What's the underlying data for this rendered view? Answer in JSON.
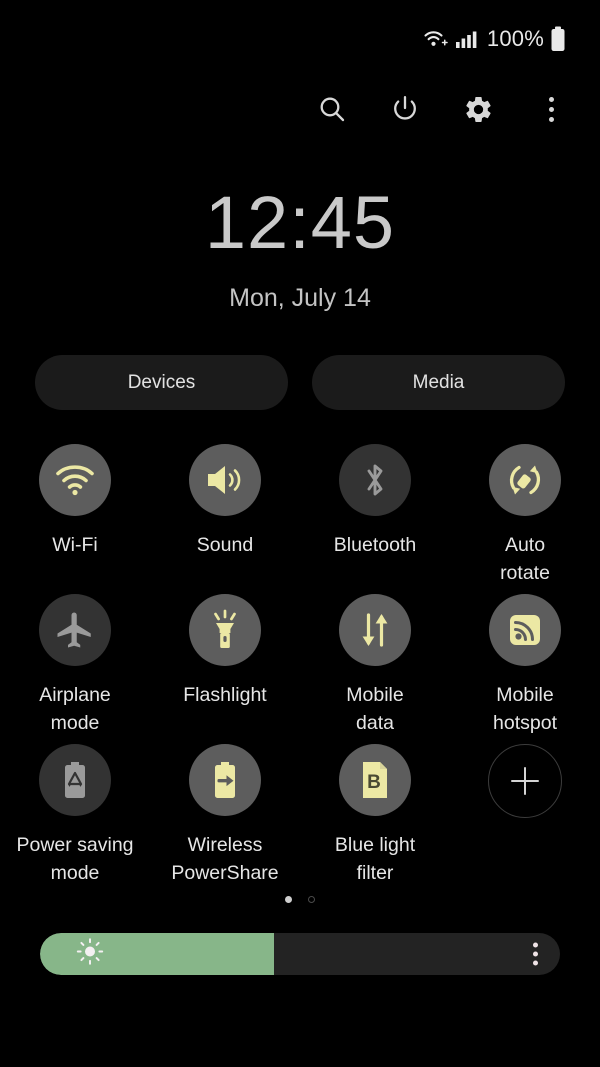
{
  "status_bar": {
    "wifi_icon": "wifi-plus-icon",
    "signal_icon": "cellular-signal-icon",
    "battery_percent": "100%",
    "battery_icon": "battery-full-icon"
  },
  "toolbar": {
    "buttons": [
      {
        "name": "search-icon",
        "label": "Search"
      },
      {
        "name": "power-icon",
        "label": "Power"
      },
      {
        "name": "settings-gear-icon",
        "label": "Settings"
      },
      {
        "name": "overflow-menu-icon",
        "label": "More options"
      }
    ]
  },
  "clock": {
    "time": "12:45",
    "date": "Mon, July 14"
  },
  "shortcuts": {
    "devices_label": "Devices",
    "media_label": "Media"
  },
  "tiles": [
    {
      "name": "wifi",
      "label": "Wi-Fi",
      "state": "on",
      "icon": "wifi-icon"
    },
    {
      "name": "sound",
      "label": "Sound",
      "state": "on",
      "icon": "sound-icon"
    },
    {
      "name": "bluetooth",
      "label": "Bluetooth",
      "state": "off",
      "icon": "bluetooth-icon"
    },
    {
      "name": "auto-rotate",
      "label": "Auto\nrotate",
      "state": "on",
      "icon": "auto-rotate-icon"
    },
    {
      "name": "airplane-mode",
      "label": "Airplane\nmode",
      "state": "off",
      "icon": "airplane-icon"
    },
    {
      "name": "flashlight",
      "label": "Flashlight",
      "state": "on",
      "icon": "flashlight-icon"
    },
    {
      "name": "mobile-data",
      "label": "Mobile\ndata",
      "state": "on",
      "icon": "mobile-data-icon"
    },
    {
      "name": "mobile-hotspot",
      "label": "Mobile\nhotspot",
      "state": "on",
      "icon": "hotspot-icon"
    },
    {
      "name": "power-saving-mode",
      "label": "Power saving\nmode",
      "state": "off",
      "icon": "power-saving-icon"
    },
    {
      "name": "wireless-powershare",
      "label": "Wireless\nPowerShare",
      "state": "on",
      "icon": "powershare-icon"
    },
    {
      "name": "blue-light-filter",
      "label": "Blue light\nfilter",
      "state": "on",
      "icon": "blue-light-filter-icon"
    },
    {
      "name": "add-tile",
      "label": "",
      "state": "add",
      "icon": "plus-icon"
    }
  ],
  "pagination": {
    "pages": 2,
    "current": 1
  },
  "brightness": {
    "value_percent": 45,
    "sun_icon": "brightness-sun-icon",
    "menu_icon": "brightness-options-icon"
  },
  "colors": {
    "accent_on": "#ece8a4",
    "icon_off": "#9a9a9a",
    "tile_on_bg": "#5d5d5d",
    "tile_off_bg": "#333333",
    "slider_fill": "#87b689",
    "background": "#000000"
  }
}
